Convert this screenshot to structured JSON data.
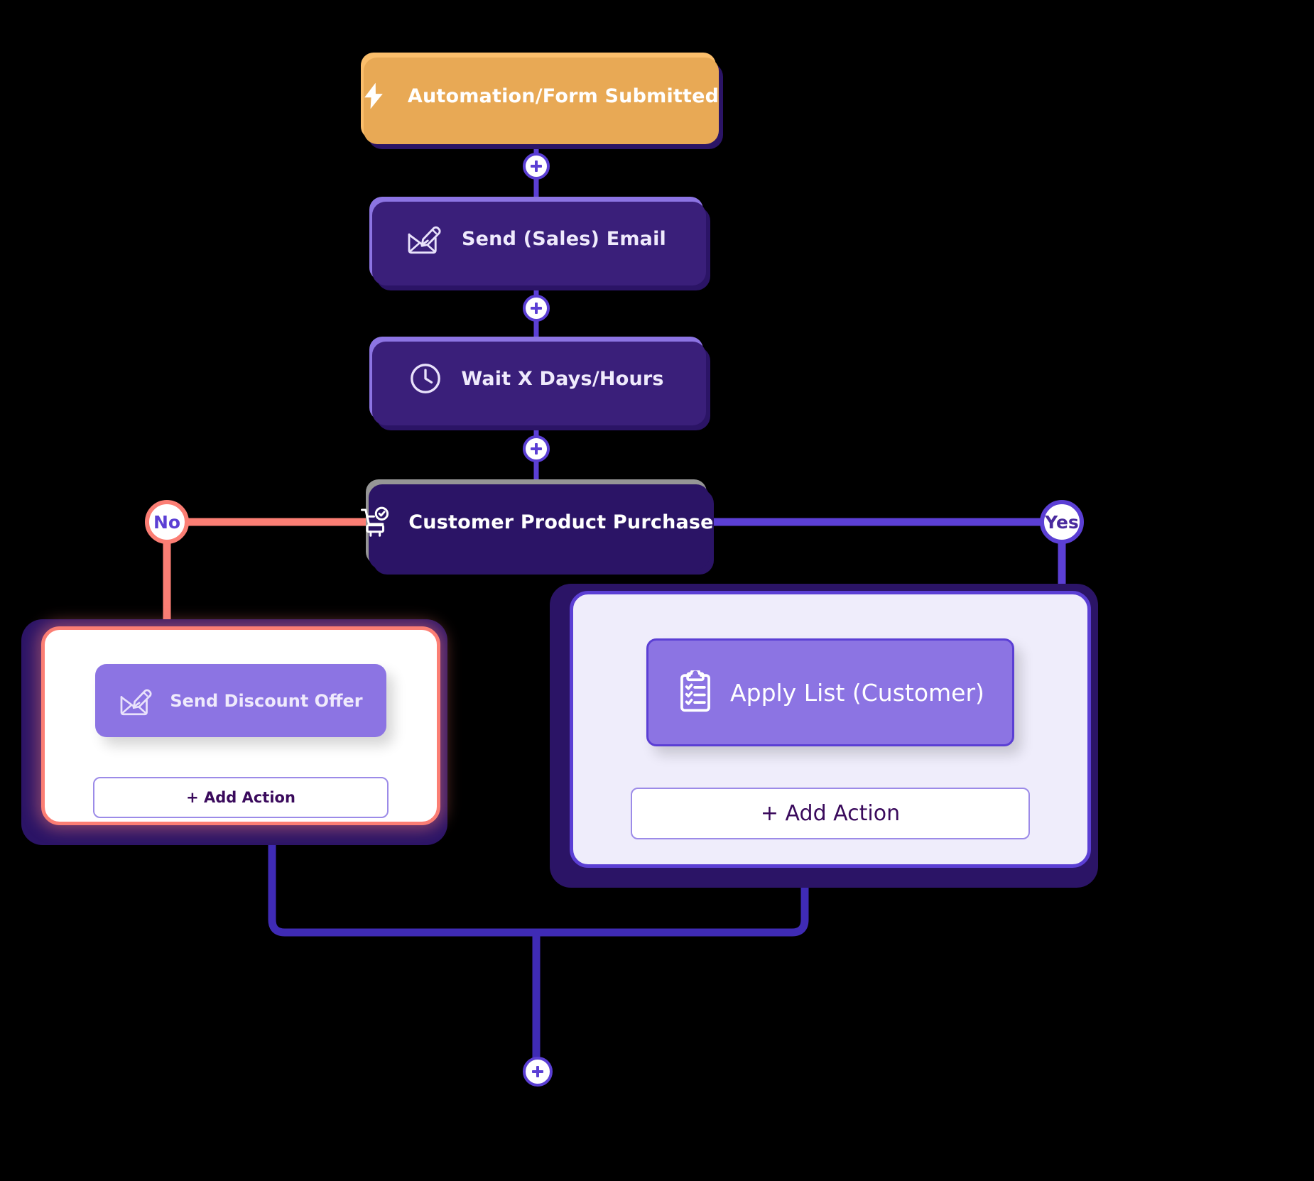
{
  "canvas": {
    "background": "#000000",
    "title": "Automation workflow builder"
  },
  "palette": {
    "trigger": "#FBBE6B",
    "action": "#8C74E3",
    "condition": "#969696",
    "accent_purple": "#5B3FD4",
    "deep_purple": "#2B1466",
    "no_coral": "#FB7E74",
    "yes_card_bg": "#EFEDFB",
    "white": "#FFFFFF"
  },
  "nodes": {
    "trigger": {
      "label": "Automation/Form Submitted",
      "icon": "lightning-bolt-icon",
      "type": "trigger"
    },
    "send_sales_email": {
      "label": "Send (Sales) Email",
      "icon": "compose-email-icon",
      "type": "action"
    },
    "wait": {
      "label": "Wait X Days/Hours",
      "icon": "clock-icon",
      "type": "action"
    },
    "condition": {
      "label": "Customer Product Purchase",
      "icon": "shopping-cart-check-icon",
      "type": "condition"
    }
  },
  "branches": {
    "no": {
      "badge": "No",
      "color": "#FB7E74",
      "action": {
        "label": "Send Discount Offer",
        "icon": "compose-email-icon"
      },
      "add_action": "+ Add Action"
    },
    "yes": {
      "badge": "Yes",
      "color": "#5B3FD4",
      "action": {
        "label": "Apply List (Customer)",
        "icon": "clipboard-checklist-icon"
      },
      "add_action": "+ Add Action"
    }
  },
  "connectors": [
    {
      "name": "plus-trigger-to-email",
      "icon": "plus-icon"
    },
    {
      "name": "plus-email-to-wait",
      "icon": "plus-icon"
    },
    {
      "name": "plus-wait-to-condition",
      "icon": "plus-icon"
    },
    {
      "name": "plus-merge-bottom",
      "icon": "plus-icon"
    }
  ]
}
